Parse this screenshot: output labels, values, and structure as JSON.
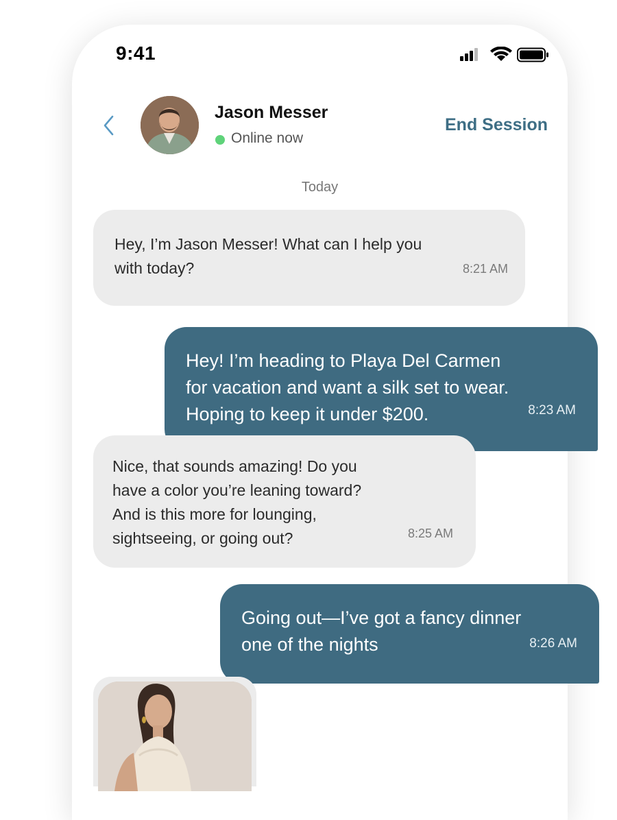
{
  "status_bar": {
    "time": "9:41"
  },
  "header": {
    "contact_name": "Jason Messer",
    "status": "Online now",
    "end_session_label": "End Session",
    "online_color": "#5fd37a",
    "accent_color": "#3e6e85"
  },
  "conversation": {
    "day_label": "Today",
    "messages": [
      {
        "sender": "agent",
        "text": "Hey, I’m Jason Messer! What can I help you\nwith today?",
        "time": "8:21 AM"
      },
      {
        "sender": "user",
        "text": "Hey! I’m heading to Playa Del Carmen\nfor vacation and want a silk set to wear.\nHoping to keep it under $200.",
        "time": "8:23 AM"
      },
      {
        "sender": "agent",
        "text": "Nice, that sounds amazing! Do you\nhave a color you’re leaning toward?\nAnd is this more for lounging,\nsightseeing, or going out?",
        "time": "8:25 AM"
      },
      {
        "sender": "user",
        "text": "Going out—I’ve got a fancy dinner\none of the nights",
        "time": "8:26 AM"
      }
    ]
  },
  "colors": {
    "incoming_bubble": "#ececec",
    "outgoing_bubble": "#3f6b81"
  },
  "icons": {
    "back": "chevron-left-icon",
    "signal": "cellular-signal-icon",
    "wifi": "wifi-icon",
    "battery": "battery-icon"
  }
}
